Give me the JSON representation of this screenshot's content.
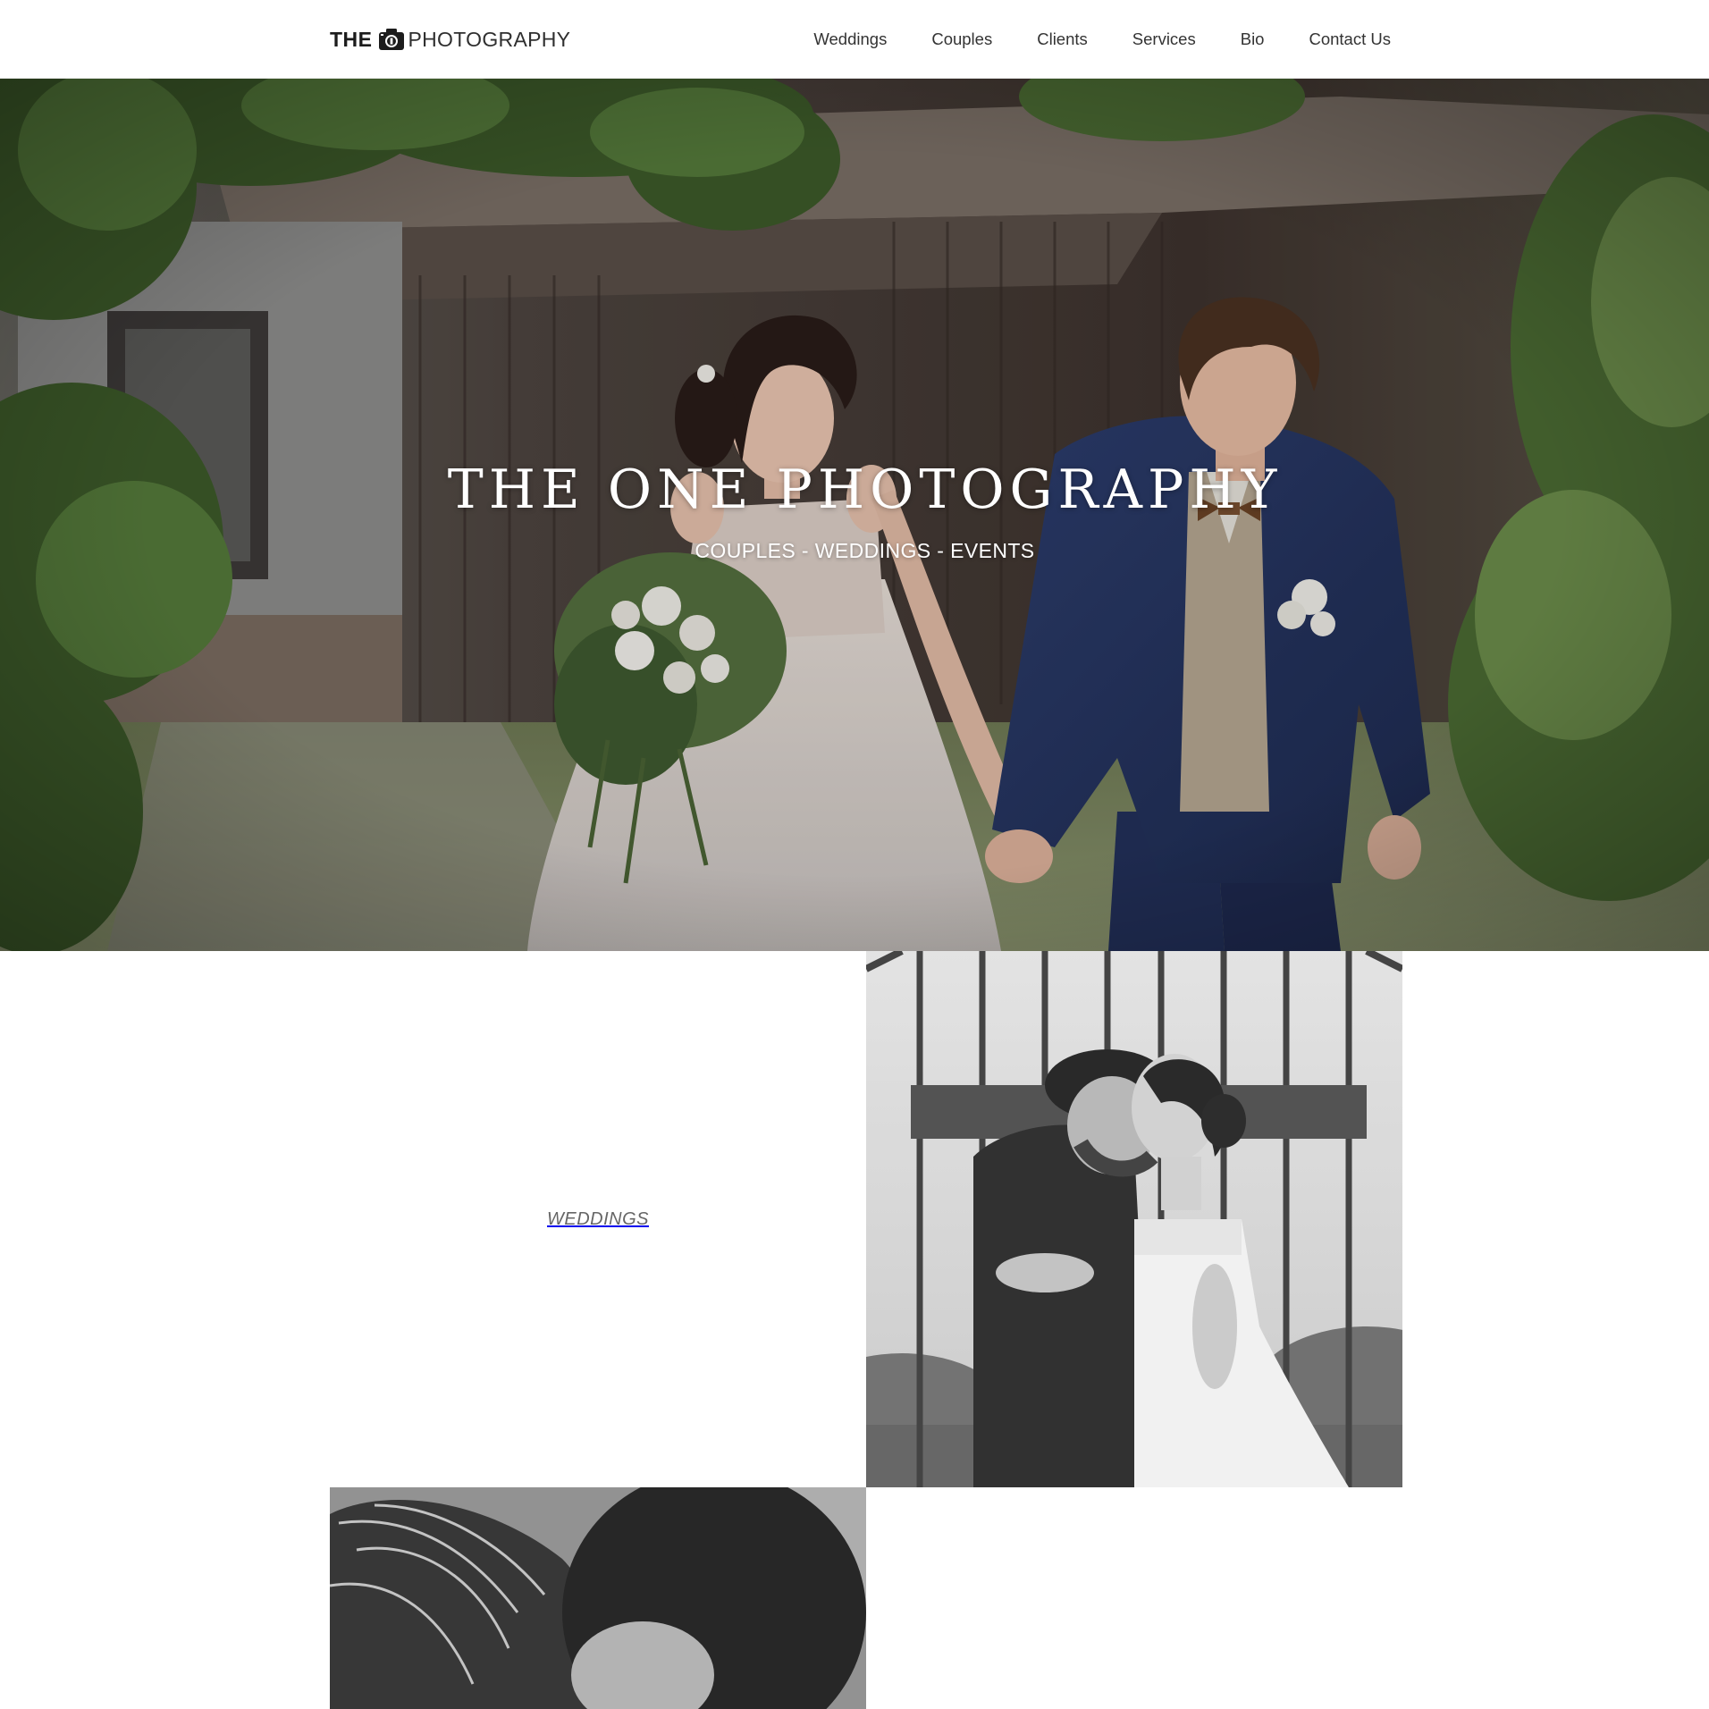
{
  "header": {
    "logo": {
      "part1": "THE",
      "icon": "camera-icon",
      "part2": "PHOTOGRAPHY"
    },
    "nav": [
      {
        "label": "Weddings"
      },
      {
        "label": "Couples"
      },
      {
        "label": "Clients"
      },
      {
        "label": "Services"
      },
      {
        "label": "Bio"
      },
      {
        "label": "Contact Us"
      }
    ]
  },
  "hero": {
    "title": "THE ONE PHOTOGRAPHY",
    "subtitle": "COUPLES - WEDDINGS - EVENTS"
  },
  "gallery": {
    "label": "WEDDINGS"
  },
  "colors": {
    "header_bg": "#ffffff",
    "text_dark": "#1c1c1c",
    "nav_text": "#333333",
    "label_text": "#666666",
    "hero_text": "#ffffff"
  }
}
